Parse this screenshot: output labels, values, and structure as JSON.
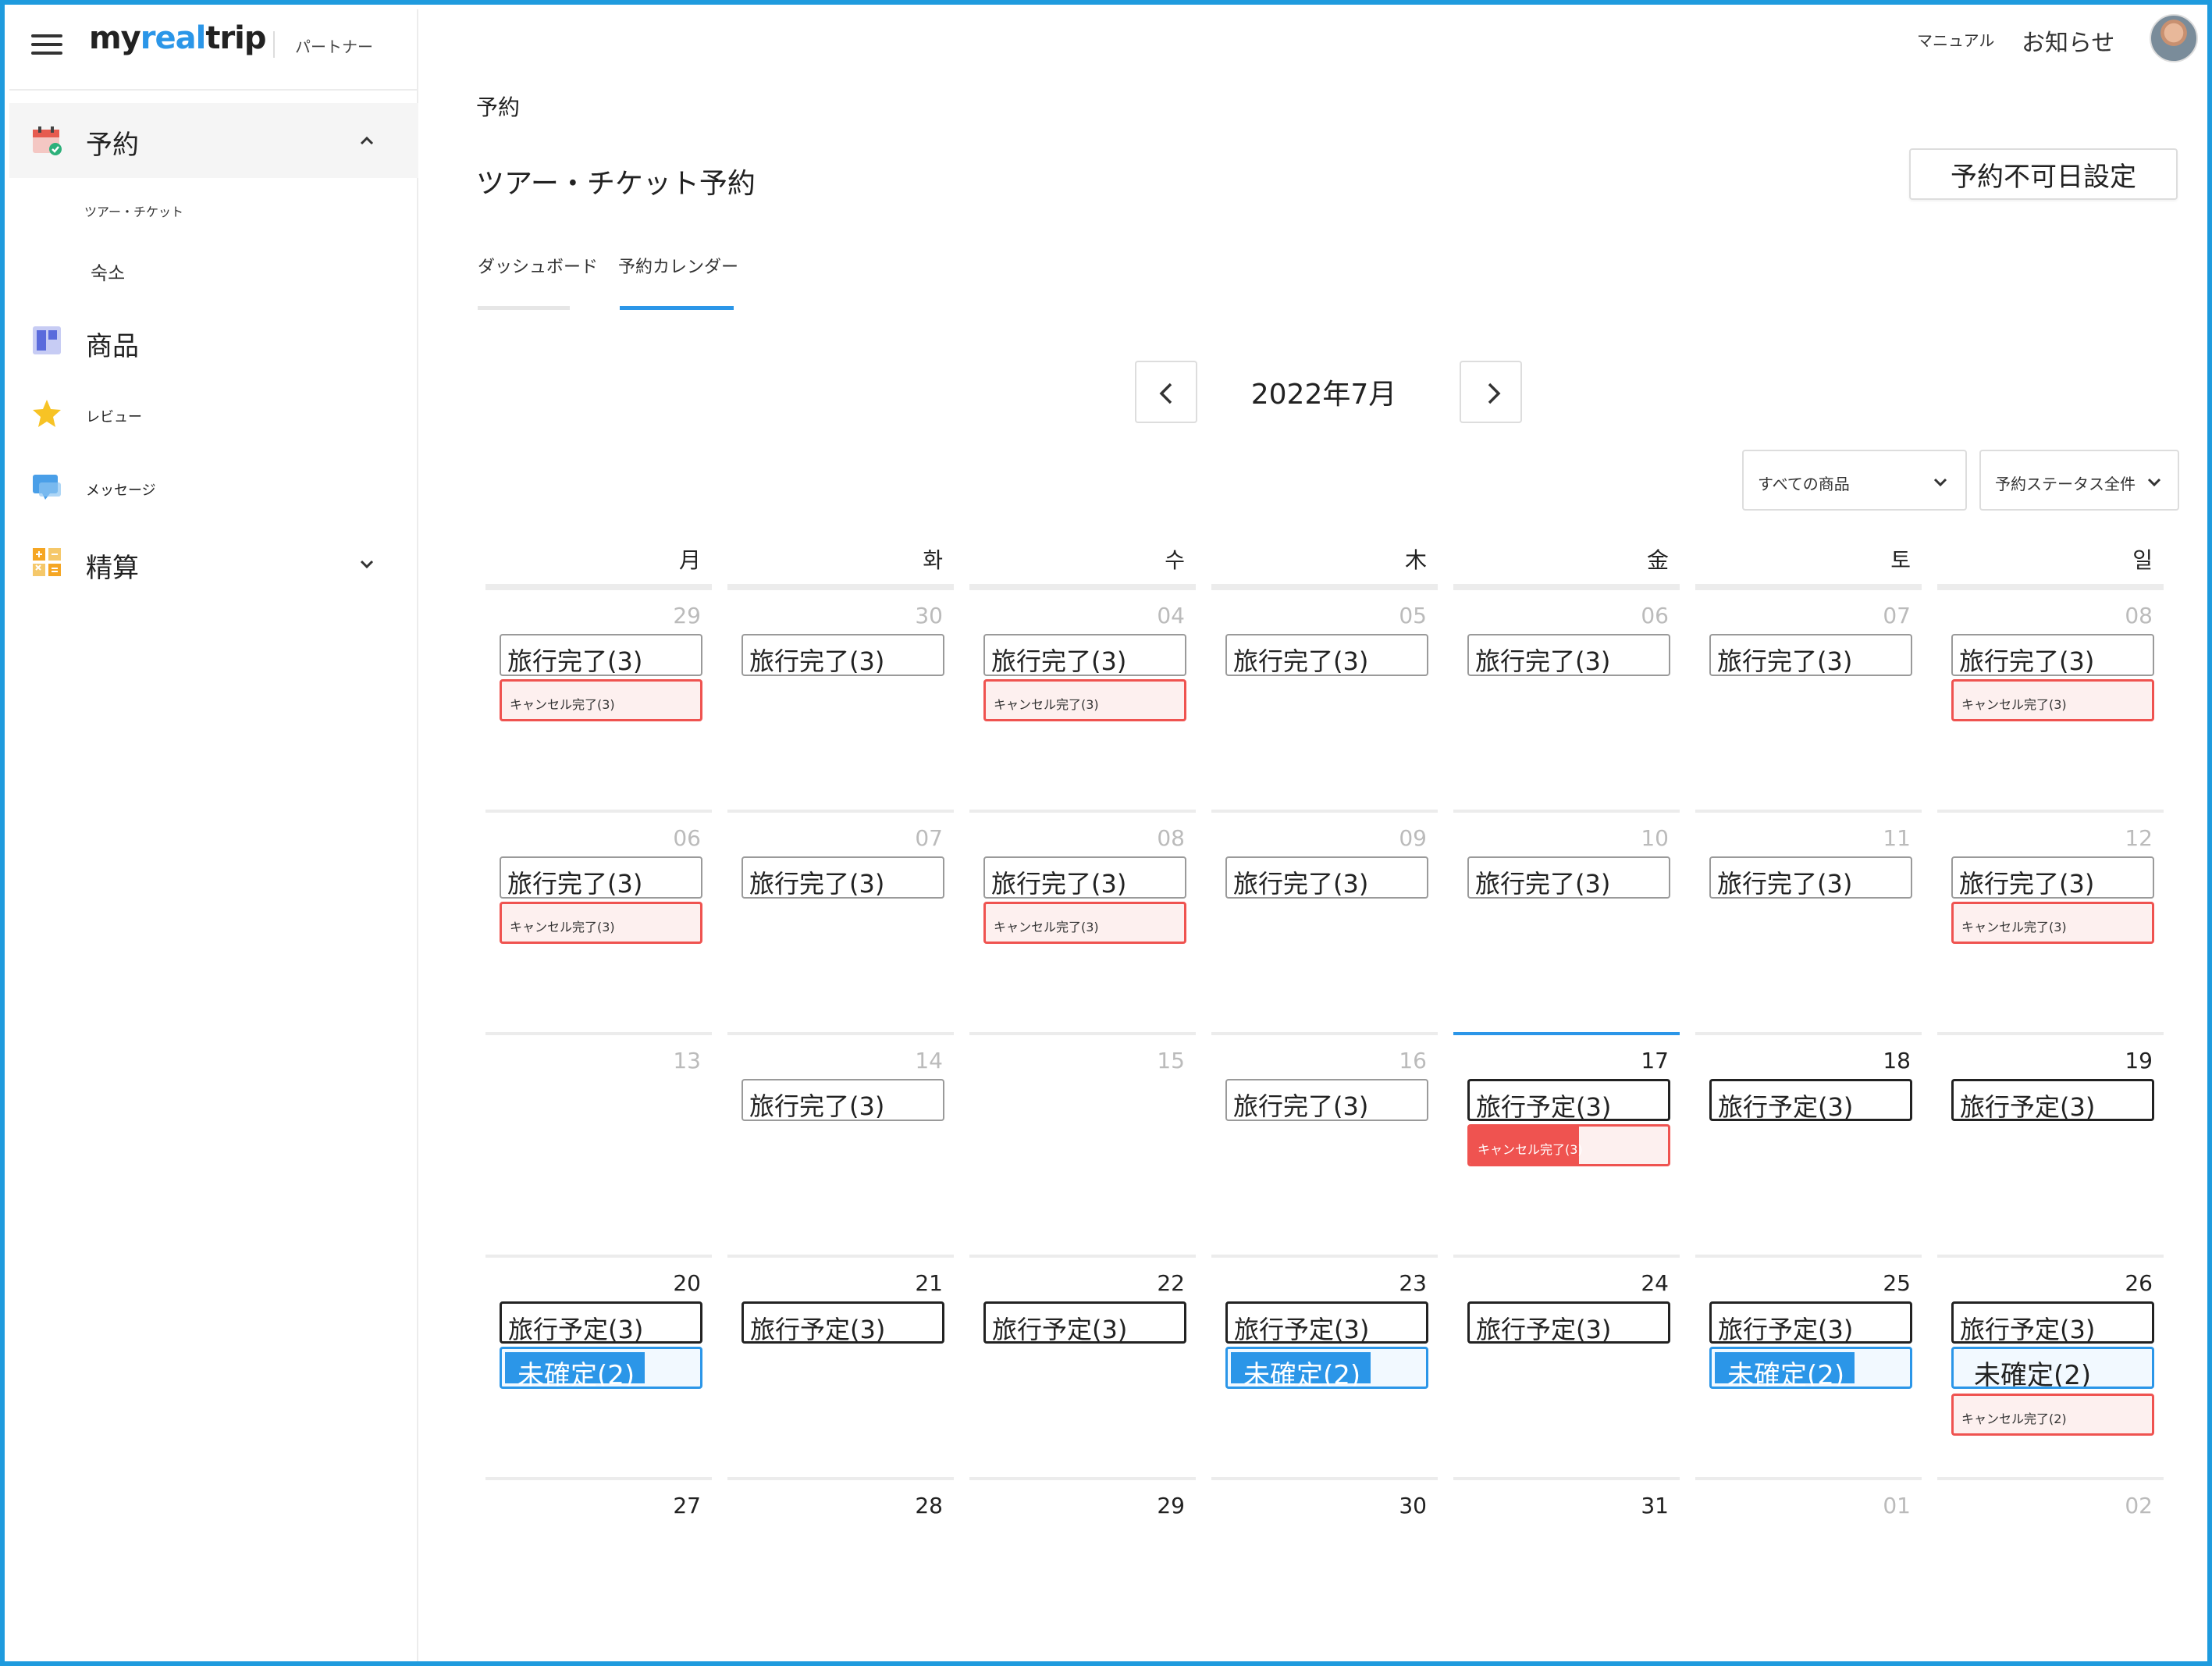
{
  "brand": {
    "logo_prefix": "my",
    "logo_accent": "real",
    "logo_suffix": "trip",
    "partner_label": "パートナー"
  },
  "header": {
    "manual_label": "マニュアル",
    "notice_label": "お知らせ"
  },
  "sidebar": {
    "reservation": "予約",
    "reservation_sub_tour": "ツアー・チケット",
    "reservation_sub_lodging": "숙소",
    "products": "商品",
    "reviews": "レビュー",
    "messages": "メッセージ",
    "settlement": "精算"
  },
  "main": {
    "breadcrumb": "予約",
    "title": "ツアー・チケット予約",
    "unavailable_button": "予約不可日設定",
    "tabs": [
      "ダッシュボード",
      "予約カレンダー"
    ],
    "active_tab": 1,
    "month_label": "2022年7月",
    "filter_product": "すべての商品",
    "filter_status": "予約ステータス全件"
  },
  "colors": {
    "accent": "#2b96e8",
    "cancel": "#ef5350",
    "frame": "#1f9bde"
  },
  "calendar": {
    "weekdays": [
      "月",
      "화",
      "수",
      "木",
      "金",
      "토",
      "일"
    ],
    "weeks": [
      [
        {
          "date": "29",
          "muted": true,
          "tags": [
            {
              "type": "done",
              "text": "旅行完了(3)"
            },
            {
              "type": "cancel",
              "text": "キャンセル完了(3)"
            }
          ]
        },
        {
          "date": "30",
          "muted": true,
          "tags": [
            {
              "type": "done",
              "text": "旅行完了(3)"
            }
          ]
        },
        {
          "date": "04",
          "muted": true,
          "tags": [
            {
              "type": "done",
              "text": "旅行完了(3)"
            },
            {
              "type": "cancel",
              "text": "キャンセル完了(3)"
            }
          ]
        },
        {
          "date": "05",
          "muted": true,
          "tags": [
            {
              "type": "done",
              "text": "旅行完了(3)"
            }
          ]
        },
        {
          "date": "06",
          "muted": true,
          "tags": [
            {
              "type": "done",
              "text": "旅行完了(3)"
            }
          ]
        },
        {
          "date": "07",
          "muted": true,
          "tags": [
            {
              "type": "done",
              "text": "旅行完了(3)"
            }
          ]
        },
        {
          "date": "08",
          "muted": true,
          "tags": [
            {
              "type": "done",
              "text": "旅行完了(3)"
            },
            {
              "type": "cancel",
              "text": "キャンセル完了(3)"
            }
          ]
        }
      ],
      [
        {
          "date": "06",
          "muted": true,
          "tags": [
            {
              "type": "done",
              "text": "旅行完了(3)"
            },
            {
              "type": "cancel",
              "text": "キャンセル完了(3)"
            }
          ]
        },
        {
          "date": "07",
          "muted": true,
          "tags": [
            {
              "type": "done",
              "text": "旅行完了(3)"
            }
          ]
        },
        {
          "date": "08",
          "muted": true,
          "tags": [
            {
              "type": "done",
              "text": "旅行完了(3)"
            },
            {
              "type": "cancel",
              "text": "キャンセル完了(3)"
            }
          ]
        },
        {
          "date": "09",
          "muted": true,
          "tags": [
            {
              "type": "done",
              "text": "旅行完了(3)"
            }
          ]
        },
        {
          "date": "10",
          "muted": true,
          "tags": [
            {
              "type": "done",
              "text": "旅行完了(3)"
            }
          ]
        },
        {
          "date": "11",
          "muted": true,
          "tags": [
            {
              "type": "done",
              "text": "旅行完了(3)"
            }
          ]
        },
        {
          "date": "12",
          "muted": true,
          "tags": [
            {
              "type": "done",
              "text": "旅行完了(3)"
            },
            {
              "type": "cancel",
              "text": "キャンセル完了(3)"
            }
          ]
        }
      ],
      [
        {
          "date": "13",
          "muted": true,
          "tags": []
        },
        {
          "date": "14",
          "muted": true,
          "tags": [
            {
              "type": "done",
              "text": "旅行完了(3)"
            }
          ]
        },
        {
          "date": "15",
          "muted": true,
          "tags": []
        },
        {
          "date": "16",
          "muted": true,
          "tags": [
            {
              "type": "done",
              "text": "旅行完了(3)"
            }
          ]
        },
        {
          "date": "17",
          "muted": false,
          "today": true,
          "tags": [
            {
              "type": "plan",
              "text": "旅行予定(3)"
            },
            {
              "type": "cancel-fill",
              "text": "キャンセル完了(3)",
              "progress": 0.55
            }
          ]
        },
        {
          "date": "18",
          "muted": false,
          "tags": [
            {
              "type": "plan",
              "text": "旅行予定(3)"
            }
          ]
        },
        {
          "date": "19",
          "muted": false,
          "tags": [
            {
              "type": "plan",
              "text": "旅行予定(3)"
            }
          ]
        }
      ],
      [
        {
          "date": "20",
          "muted": false,
          "tags": [
            {
              "type": "plan",
              "text": "旅行予定(3)"
            },
            {
              "type": "unconf",
              "text": "未確定(2)",
              "progress": 0.72
            }
          ]
        },
        {
          "date": "21",
          "muted": false,
          "tags": [
            {
              "type": "plan",
              "text": "旅行予定(3)"
            }
          ]
        },
        {
          "date": "22",
          "muted": false,
          "tags": [
            {
              "type": "plan",
              "text": "旅行予定(3)"
            }
          ]
        },
        {
          "date": "23",
          "muted": false,
          "tags": [
            {
              "type": "plan",
              "text": "旅行予定(3)"
            },
            {
              "type": "unconf",
              "text": "未確定(2)",
              "progress": 0.72
            }
          ]
        },
        {
          "date": "24",
          "muted": false,
          "tags": [
            {
              "type": "plan",
              "text": "旅行予定(3)"
            }
          ]
        },
        {
          "date": "25",
          "muted": false,
          "tags": [
            {
              "type": "plan",
              "text": "旅行予定(3)"
            },
            {
              "type": "unconf",
              "text": "未確定(2)",
              "progress": 0.72
            }
          ]
        },
        {
          "date": "26",
          "muted": false,
          "tags": [
            {
              "type": "plan",
              "text": "旅行予定(3)"
            },
            {
              "type": "unconf",
              "text": "未確定(2)",
              "progress": 0
            },
            {
              "type": "cancel",
              "text": "キャンセル完了(2)"
            }
          ]
        }
      ],
      [
        {
          "date": "27",
          "muted": false,
          "tags": []
        },
        {
          "date": "28",
          "muted": false,
          "tags": []
        },
        {
          "date": "29",
          "muted": false,
          "tags": []
        },
        {
          "date": "30",
          "muted": false,
          "tags": []
        },
        {
          "date": "31",
          "muted": false,
          "tags": []
        },
        {
          "date": "01",
          "muted": true,
          "tags": []
        },
        {
          "date": "02",
          "muted": true,
          "tags": []
        }
      ]
    ]
  }
}
